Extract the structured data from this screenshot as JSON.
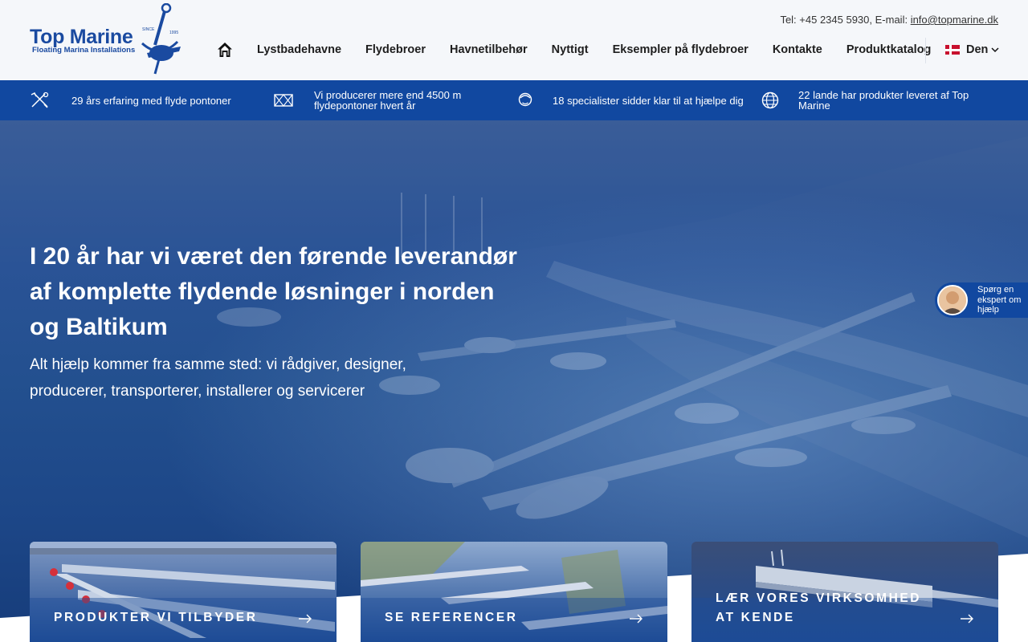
{
  "brand": {
    "name": "Top Marine",
    "tagline": "Floating Marina Installations",
    "since": "SINCE 1995"
  },
  "contact": {
    "phone_text": "Tel: +45 2345 5930, E-mail: ",
    "email": "info@topmarine.dk"
  },
  "nav": {
    "items": [
      "Lystbadehavne",
      "Flydebroer",
      "Havnetilbehør",
      "Nyttigt",
      "Eksempler på flydebroer",
      "Kontakte",
      "Produktkatalog"
    ],
    "language": "Den"
  },
  "features": [
    {
      "icon": "tools-icon",
      "text": "29 års erfaring med flyde pontoner"
    },
    {
      "icon": "pontoon-icon",
      "text": "Vi producerer mere end 4500 m flydepontoner hvert år"
    },
    {
      "icon": "specialist-icon",
      "text": "18 specialister sidder klar til at hjælpe dig"
    },
    {
      "icon": "globe-icon",
      "text": "22 lande har produkter leveret af Top Marine"
    }
  ],
  "hero": {
    "heading": "I 20 år har vi været den førende leverandør af komplette flydende løsninger i norden og Baltikum",
    "subheading": "Alt hjælp kommer fra samme sted: vi rådgiver, designer, producerer, transporterer, installerer og servicerer"
  },
  "expert_widget": {
    "text": "Spørg en ekspert om hjælp"
  },
  "cards": [
    {
      "label": "PRODUKTER VI TILBYDER"
    },
    {
      "label": "SE REFERENCER"
    },
    {
      "label": "LÆR VORES VIRKSOMHED AT KENDE"
    }
  ],
  "colors": {
    "brand_blue": "#1148a0",
    "hero_blue": "#23508f"
  }
}
